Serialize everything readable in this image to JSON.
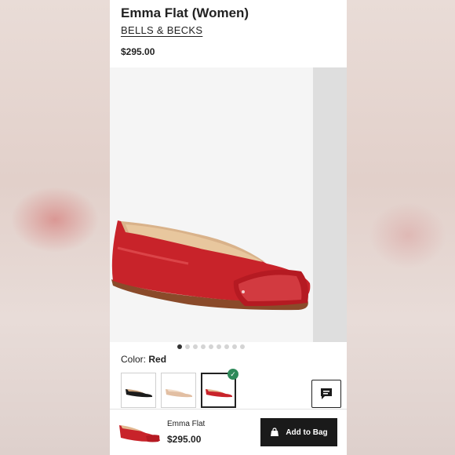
{
  "product": {
    "title": "Emma Flat (Women)",
    "brand": "BELLS & BECKS",
    "price": "$295.00"
  },
  "gallery": {
    "image_count": 9,
    "active_index": 0
  },
  "color": {
    "label": "Color:",
    "selected": "Red",
    "swatches": [
      "black",
      "nude",
      "red"
    ],
    "selected_index": 2
  },
  "bottom_bar": {
    "name": "Emma Flat",
    "price": "$295.00",
    "add_label": "Add to Bag"
  },
  "colors": {
    "shoe_red": "#c8232a",
    "check_green": "#2e8a5a",
    "button_dark": "#1a1a1a"
  }
}
